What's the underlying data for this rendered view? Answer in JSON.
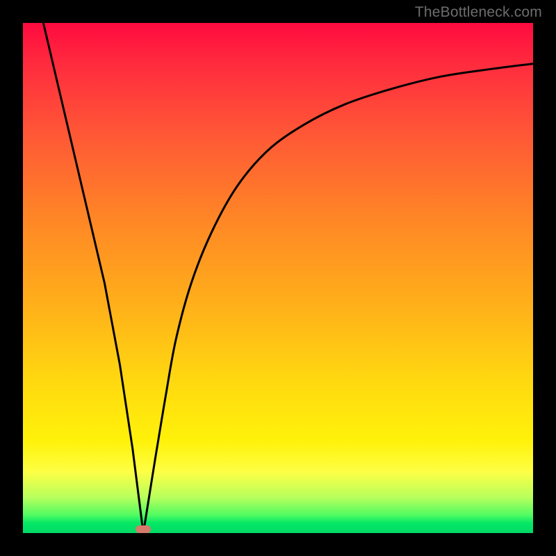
{
  "watermark": {
    "text": "TheBottleneck.com"
  },
  "colors": {
    "curve_stroke": "#000000",
    "marker_fill": "#d67a6c",
    "gradient_top": "#ff0a3f",
    "gradient_bottom": "#00d966",
    "frame": "#000000"
  },
  "chart_data": {
    "type": "line",
    "title": "",
    "xlabel": "",
    "ylabel": "",
    "xlim": [
      0,
      100
    ],
    "ylim": [
      0,
      100
    ],
    "grid": false,
    "axes_visible": false,
    "note": "Axis values are normalized percentages of the plot area (0 = left/bottom, 100 = right/top). No numeric tick labels are shown in the source image.",
    "series": [
      {
        "name": "left-descent",
        "x": [
          4,
          8,
          12,
          16,
          19,
          21.5,
          23.6
        ],
        "values": [
          100,
          83,
          66,
          49,
          33,
          16.5,
          0
        ]
      },
      {
        "name": "right-ascent",
        "x": [
          23.6,
          26,
          28,
          30,
          33,
          37,
          42,
          48,
          55,
          63,
          72,
          82,
          92,
          100
        ],
        "values": [
          0,
          15,
          27,
          38,
          49,
          59,
          68,
          75,
          80,
          84,
          87,
          89.5,
          91,
          92
        ]
      }
    ],
    "marker": {
      "shape": "pill",
      "x": 23.6,
      "y": 0.8,
      "width_pct": 3.0,
      "height_pct": 1.5
    }
  }
}
